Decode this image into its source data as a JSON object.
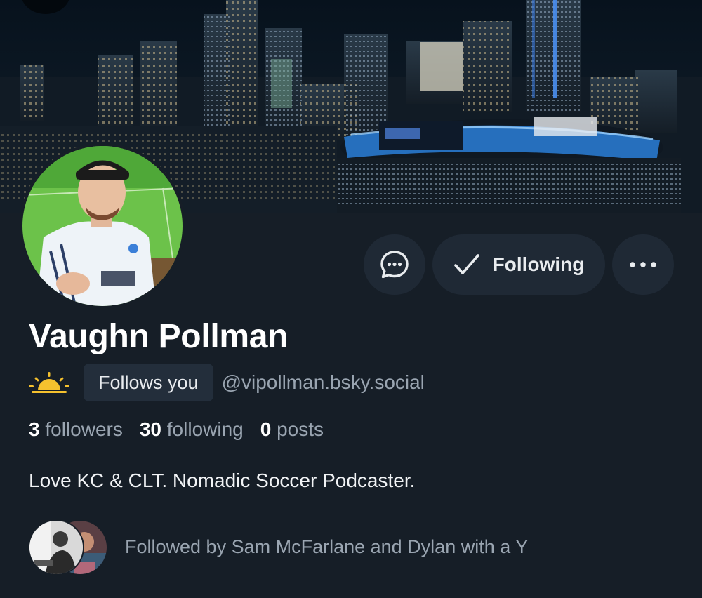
{
  "profile": {
    "display_name": "Vaughn Pollman",
    "handle": "@vipollman.bsky.social",
    "follows_you_badge": "Follows you",
    "status_emoji": "sunrise-icon",
    "bio": "Love KC & CLT. Nomadic Soccer Podcaster."
  },
  "stats": {
    "followers_count": "3",
    "followers_label": "followers",
    "following_count": "30",
    "following_label": "following",
    "posts_count": "0",
    "posts_label": "posts"
  },
  "actions": {
    "message_icon": "chat-bubble-icon",
    "following_label": "Following",
    "following_icon": "checkmark-icon",
    "more_icon": "ellipsis-icon"
  },
  "followed_by": {
    "text": "Followed by Sam McFarlane and Dylan with a Y"
  },
  "colors": {
    "background": "#161e27",
    "button_bg": "#1f2935",
    "badge_bg": "#232e3b",
    "muted_text": "#9aa5b1",
    "sun_yellow": "#f5c12e"
  }
}
